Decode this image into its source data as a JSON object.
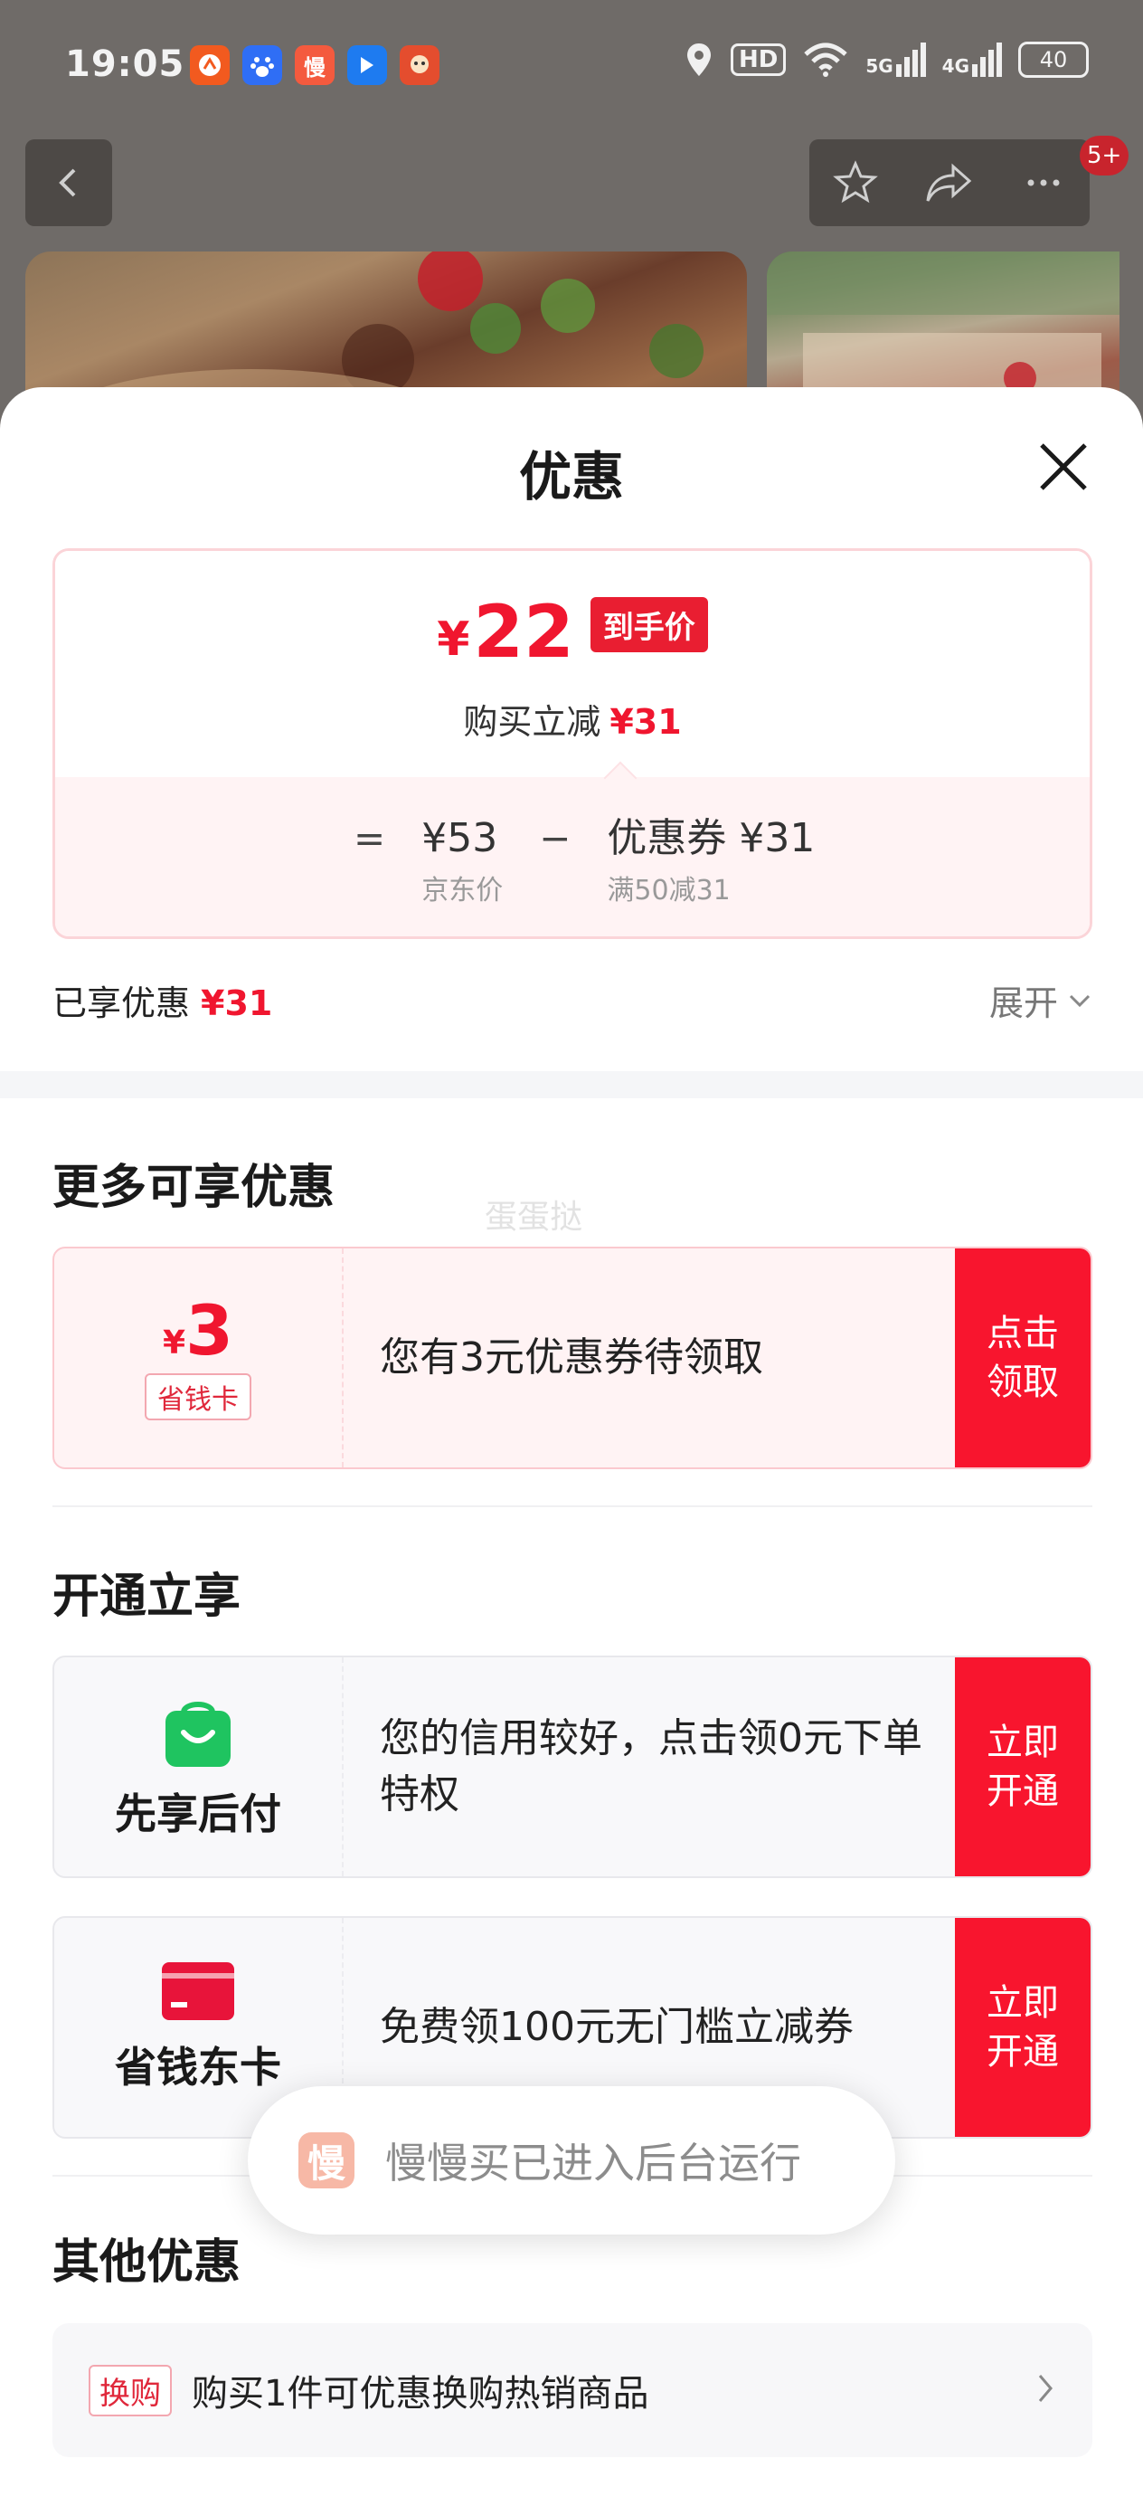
{
  "status_bar": {
    "time": "19:05",
    "hd_label": "HD",
    "net_5g": "5G",
    "net_4g": "4G",
    "battery": "40",
    "app_icons": [
      "app-icon-orange",
      "app-icon-baidu",
      "app-icon-manman",
      "app-icon-blue",
      "app-icon-game"
    ],
    "app_icon_manman_text": "慢"
  },
  "background_page": {
    "badge": "5+"
  },
  "sheet": {
    "title": "优惠",
    "price_card": {
      "yen": "¥",
      "final_price": "22",
      "final_label": "到手价",
      "discount_text": "购买立减",
      "discount_value": "¥31",
      "equals": "=",
      "minus": "−",
      "jd_price": "¥53",
      "jd_price_label": "京东价",
      "coupon_value": "优惠券 ¥31",
      "coupon_rule": "满50减31"
    },
    "enjoyed_label": "已享优惠",
    "enjoyed_value": "¥31",
    "expand_label": "展开",
    "more_section": {
      "title": "更多可享优惠",
      "watermark": "蛋蛋挞",
      "card": {
        "yen": "¥",
        "amount": "3",
        "tag": "省钱卡",
        "text": "您有3元优惠券待领取",
        "button": "点击领取"
      }
    },
    "open_section": {
      "title": "开通立享",
      "cards": [
        {
          "label": "先享后付",
          "text": "您的信用较好，点击领0元下单特权",
          "button": "立即开通"
        },
        {
          "label": "省钱东卡",
          "text": "免费领100元无门槛立减券",
          "button": "立即开通"
        }
      ]
    },
    "other_section": {
      "title": "其他优惠",
      "tag": "换购",
      "text": "购买1件可优惠换购热销商品"
    }
  },
  "toast": {
    "icon_text": "慢",
    "text": "慢慢买已进入后台运行"
  },
  "colors": {
    "accent_red": "#f8152e",
    "price_red": "#f0162f",
    "green": "#1fc460"
  }
}
